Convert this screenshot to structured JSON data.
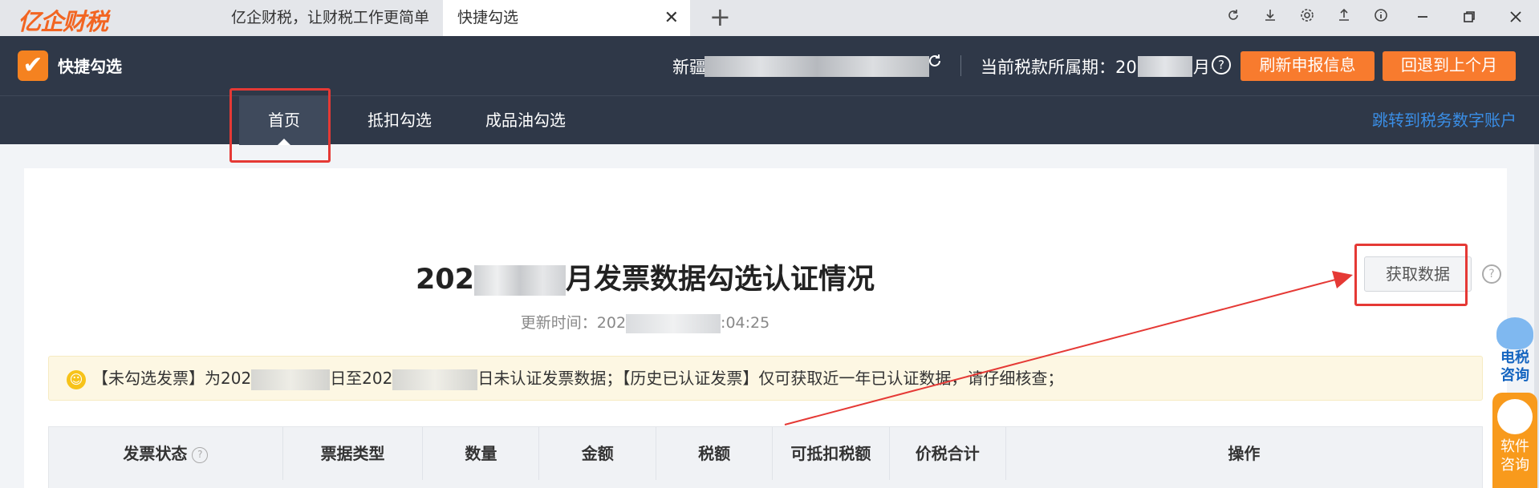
{
  "browser": {
    "logo": "亿企财税",
    "tabs": [
      {
        "label": "亿企财税，让财税工作更简单"
      },
      {
        "label": "快捷勾选",
        "close": "✕"
      }
    ],
    "new_tab": "+",
    "icons": [
      "refresh-icon",
      "download-icon",
      "settings-icon",
      "share-icon",
      "info-icon",
      "minimize-icon",
      "restore-icon",
      "close-icon"
    ]
  },
  "app": {
    "logo_glyph": "✔",
    "name": "快捷勾选",
    "company_prefix": "新疆",
    "period_label": "当前税款所属期：20",
    "period_suffix": "月",
    "help": "?",
    "refresh_btn": "刷新申报信息",
    "back_btn": "回退到上个月"
  },
  "nav": {
    "items": [
      {
        "label": "首页"
      },
      {
        "label": "抵扣勾选"
      },
      {
        "label": "成品油勾选"
      }
    ],
    "link": "跳转到税务数字账户"
  },
  "main": {
    "title_prefix": "202",
    "title_suffix": "月发票数据勾选认证情况",
    "update_prefix": "更新时间：202",
    "update_suffix": ":04:25",
    "fetch_btn": "获取数据",
    "fetch_help": "?",
    "notice": {
      "icon": "☺",
      "part1": "【未勾选发票】为202",
      "part2": "日至202",
      "part3": "日未认证发票数据；【历史已认证发票】仅可获取近一年已认证数据，请仔细核查；"
    },
    "table_headers": [
      "发票状态",
      "票据类型",
      "数量",
      "金额",
      "税额",
      "可抵扣税额",
      "价税合计",
      "操作"
    ],
    "status_help": "?"
  },
  "widgets": {
    "tax_consult": "电税\n咨询",
    "tax_line1": "电税",
    "tax_line2": "咨询",
    "soft_line1": "软件",
    "soft_line2": "咨询"
  },
  "colors": {
    "header_bg": "#2f3848",
    "accent_orange": "#f87b2e",
    "link_blue": "#3a8ee6",
    "annotation_red": "#e53935"
  }
}
